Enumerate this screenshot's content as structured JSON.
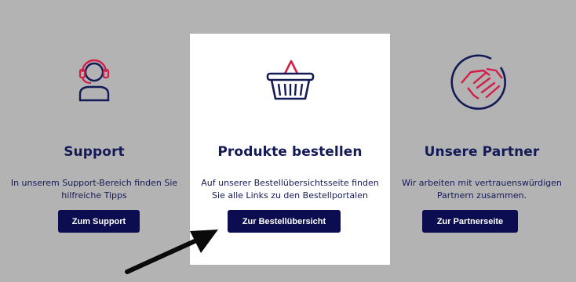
{
  "support": {
    "icon": "headset-support-icon",
    "title": "Support",
    "desc_line1": "In unserem Support-Bereich finden Sie",
    "desc_line2": "hilfreiche Tipps",
    "button_label": "Zum Support"
  },
  "order": {
    "icon": "shopping-basket-icon",
    "title": "Produkte bestellen",
    "desc_line1": "Auf unserer Bestellübersichtsseite finden",
    "desc_line2": "Sie alle Links zu den Bestellportalen",
    "button_label": "Zur Bestellübersicht"
  },
  "partner": {
    "icon": "handshake-icon",
    "title": "Unsere Partner",
    "desc_line1": "Wir arbeiten mit vertrauenswürdigen",
    "desc_line2": "Partnern zusammen.",
    "button_label": "Zur Partnerseite"
  },
  "colors": {
    "navy": "#141a56",
    "button": "#0c0d50",
    "accent_red": "#d11f4a",
    "backdrop": "#b3b3b3"
  },
  "annotation": {
    "icon": "pointer-arrow-icon"
  }
}
